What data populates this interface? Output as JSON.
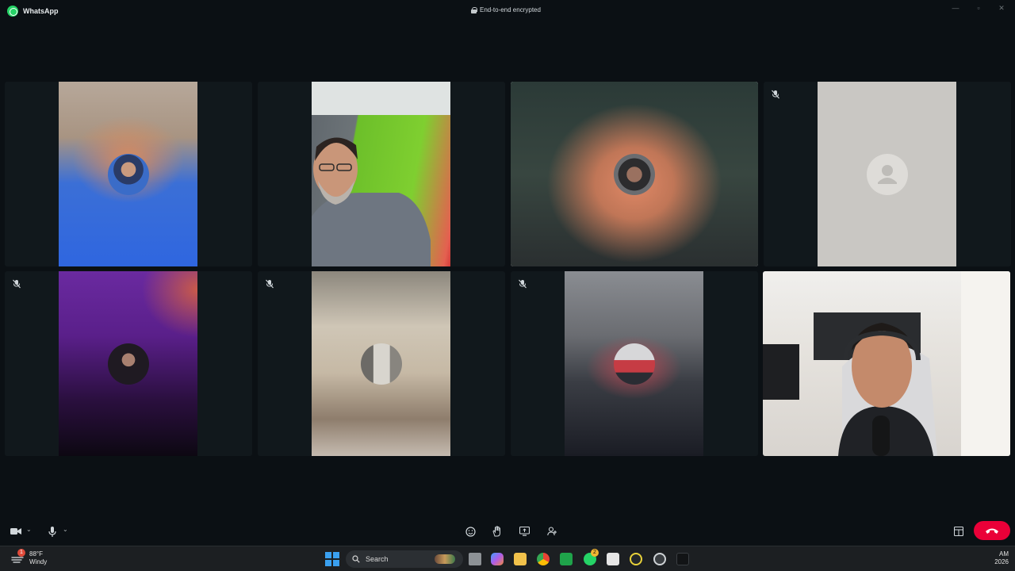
{
  "window": {
    "app_name": "WhatsApp",
    "encryption_label": "End-to-end encrypted"
  },
  "call": {
    "participants": [
      {
        "id": "p1",
        "muted": false,
        "video": false,
        "active_speaker": false,
        "background": "blue-blurred"
      },
      {
        "id": "p2",
        "muted": false,
        "video": true,
        "active_speaker": false,
        "background": "green-screen"
      },
      {
        "id": "p3",
        "muted": false,
        "video": false,
        "active_speaker": true,
        "background": "peach-blurred"
      },
      {
        "id": "p4",
        "muted": true,
        "video": false,
        "active_speaker": false,
        "background": "grey-placeholder"
      },
      {
        "id": "p5",
        "muted": true,
        "video": false,
        "active_speaker": false,
        "background": "purple-blurred"
      },
      {
        "id": "p6",
        "muted": true,
        "video": false,
        "active_speaker": false,
        "background": "beige-blurred"
      },
      {
        "id": "p7",
        "muted": true,
        "video": false,
        "active_speaker": false,
        "background": "grey-red-blurred"
      },
      {
        "id": "p8",
        "muted": false,
        "video": true,
        "active_speaker": false,
        "background": "self-view-room"
      }
    ],
    "controls": [
      "camera",
      "microphone",
      "emoji-reactions",
      "raise-hand",
      "share-screen",
      "participants",
      "layout",
      "end-call"
    ]
  },
  "taskbar": {
    "weather_temp": "88°F",
    "weather_desc": "Windy",
    "weather_badge": "1",
    "search_label": "Search",
    "whatsapp_badge": "2",
    "clock_line1": "AM",
    "clock_line2": "2026"
  },
  "colors": {
    "background": "#0b1014",
    "tile": "#11181c",
    "accent_green": "#25d366",
    "end_call_red": "#ea0038",
    "active_outline": "#ffffff"
  }
}
